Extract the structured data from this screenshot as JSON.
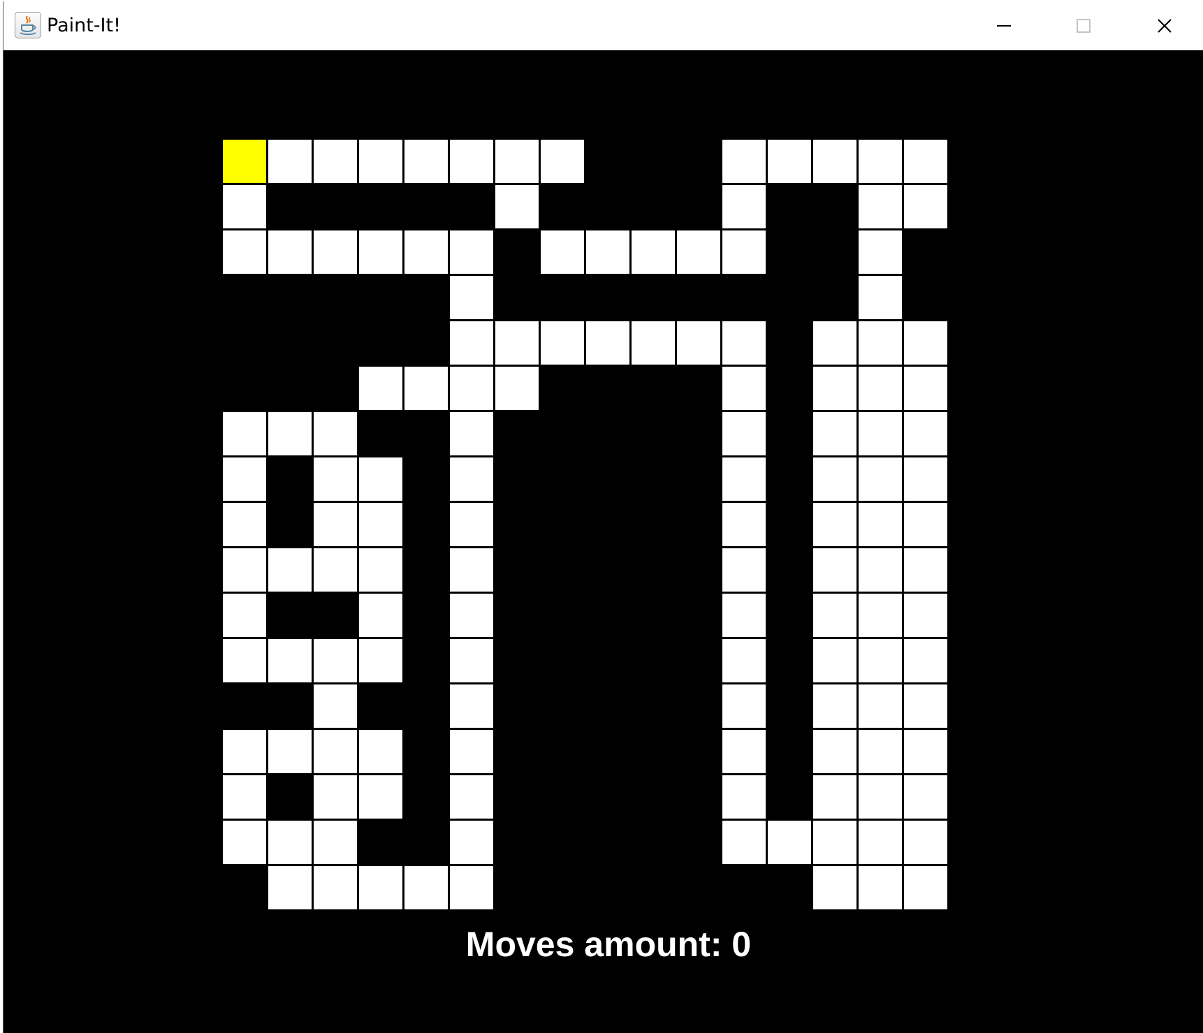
{
  "window": {
    "title": "Paint-It!",
    "app_icon": "java-cup-icon",
    "controls": [
      "minimize-icon",
      "maximize-icon",
      "close-icon"
    ]
  },
  "colors": {
    "background": "#000000",
    "unpainted": "#ffffff",
    "painted": "#ffff00",
    "wall": "#000000"
  },
  "game": {
    "moves_label": "Moves amount: 0",
    "grid_rows": 17,
    "grid_cols": 16,
    "grid": [
      "Y#######...#####",
      "#.....#....#..##",
      "######.#####..#.",
      ".....#........#.",
      ".....#######.###",
      "...####....#.###",
      "###..#.....#.###",
      "#.##.#.....#.###",
      "#.##.#.....#.###",
      "####.#.....#.###",
      "#..#.#.....#.###",
      "####.#.....#.###",
      "..#..#.....#.###",
      "####.#.....#.###",
      "#.##.#.....#.###",
      "###..#.....#####",
      ".#####.......###"
    ],
    "legend": {
      "Y": "painted",
      "#": "unpainted",
      ".": "wall"
    }
  }
}
